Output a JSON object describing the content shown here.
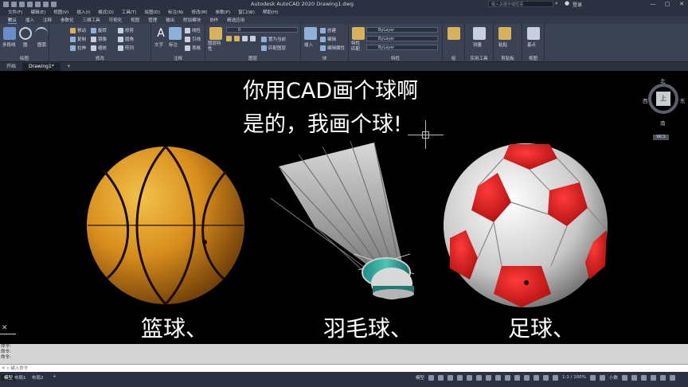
{
  "titlebar": {
    "title": "Autodesk AutoCAD 2020    Drawing1.dwg",
    "search_placeholder": "键入关键字或短语",
    "login": "登录",
    "minimize": "—",
    "maximize": "▢",
    "close": "✕"
  },
  "menubar": {
    "items": [
      "文件(F)",
      "编辑(E)",
      "视图(V)",
      "插入(I)",
      "格式(O)",
      "工具(T)",
      "绘图(D)",
      "标注(N)",
      "修改(M)",
      "参数(P)",
      "窗口(W)",
      "帮助(H)"
    ]
  },
  "ribbon_tabs": {
    "items": [
      "默认",
      "插入",
      "注释",
      "参数化",
      "三维工具",
      "可视化",
      "视图",
      "管理",
      "输出",
      "附加模块",
      "协作",
      "精选应用"
    ]
  },
  "ribbon": {
    "draw": {
      "label": "绘图",
      "polyline": "多段线",
      "circle": "圆",
      "arc": "圆弧"
    },
    "modify": {
      "label": "修改",
      "move": "移动",
      "rotate": "旋转",
      "trim": "修剪",
      "copy": "复制",
      "mirror": "镜像",
      "fillet": "圆角",
      "stretch": "拉伸",
      "scale": "缩放",
      "array": "阵列"
    },
    "annotation": {
      "label": "注释",
      "text": "文字",
      "dimension": "标注",
      "leader": "引线",
      "table": "表格",
      "linear": "线性"
    },
    "layers": {
      "label": "图层",
      "layer_props": "图层特性",
      "layer_value": "0",
      "set_current": "置为当前",
      "match_layer": "匹配图层"
    },
    "block": {
      "label": "块",
      "insert": "插入",
      "create": "创建",
      "edit": "编辑",
      "edit_attr": "编辑属性"
    },
    "properties": {
      "label": "特性",
      "match": "特性匹配",
      "color": "ByLayer",
      "linetype": "ByLayer",
      "lineweight": "ByLayer"
    },
    "groups": {
      "label": "组"
    },
    "utilities": {
      "label": "实用工具",
      "measure": "测量"
    },
    "clipboard": {
      "label": "剪贴板",
      "paste": "粘贴"
    },
    "view": {
      "label": "视图",
      "base": "基点"
    }
  },
  "filetabs": {
    "start": "开始",
    "drawing": "Drawing1*",
    "add": "+"
  },
  "canvas": {
    "caption_line1": "你用CAD画个球啊",
    "caption_line2": "是的，我画个球!",
    "label_basketball": "篮球、",
    "label_shuttlecock": "羽毛球、",
    "label_soccer": "足球、",
    "navcube": {
      "top": "上",
      "north": "北",
      "south": "南",
      "west": "西",
      "east": "东",
      "wcs": "WCS"
    }
  },
  "command": {
    "history": [
      "命令:",
      "命令:",
      "命令:"
    ],
    "placeholder": "键入命令"
  },
  "statusbar": {
    "model_tab": "模型",
    "layout1": "布局1",
    "layout2": "布局2",
    "add": "+",
    "model_button": "模型",
    "scale": "1:1 / 100%",
    "decimal": "小数"
  }
}
